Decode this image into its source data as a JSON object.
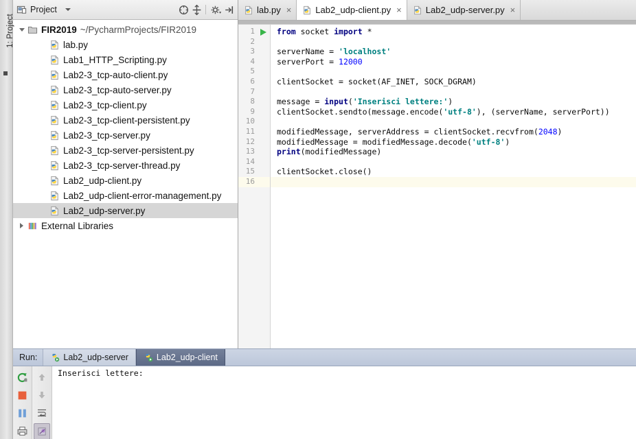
{
  "window": {
    "left_strip_tab": "1: Project"
  },
  "project_panel": {
    "title": "Project",
    "icon": "project-view-icon",
    "toolbar": [
      {
        "name": "collapse-all-icon",
        "label": "Collapse All"
      },
      {
        "name": "scroll-from-source-icon",
        "label": "Scroll from Source"
      },
      {
        "name": "gear-icon",
        "label": "Settings"
      },
      {
        "name": "hide-panel-icon",
        "label": "Hide"
      }
    ],
    "tree": [
      {
        "level": 1,
        "arrow": "down",
        "icon": "folder-icon",
        "name": "FIR2019",
        "bold": true,
        "path": "~/PycharmProjects/FIR2019",
        "selected": false
      },
      {
        "level": 2,
        "arrow": "none",
        "icon": "python-file-icon",
        "name": "lab.py",
        "bold": false,
        "path": "",
        "selected": false
      },
      {
        "level": 2,
        "arrow": "none",
        "icon": "python-file-icon",
        "name": "Lab1_HTTP_Scripting.py",
        "bold": false,
        "path": "",
        "selected": false
      },
      {
        "level": 2,
        "arrow": "none",
        "icon": "python-file-icon",
        "name": "Lab2-3_tcp-auto-client.py",
        "bold": false,
        "path": "",
        "selected": false
      },
      {
        "level": 2,
        "arrow": "none",
        "icon": "python-file-icon",
        "name": "Lab2-3_tcp-auto-server.py",
        "bold": false,
        "path": "",
        "selected": false
      },
      {
        "level": 2,
        "arrow": "none",
        "icon": "python-file-icon",
        "name": "Lab2-3_tcp-client.py",
        "bold": false,
        "path": "",
        "selected": false
      },
      {
        "level": 2,
        "arrow": "none",
        "icon": "python-file-icon",
        "name": "Lab2-3_tcp-client-persistent.py",
        "bold": false,
        "path": "",
        "selected": false
      },
      {
        "level": 2,
        "arrow": "none",
        "icon": "python-file-icon",
        "name": "Lab2-3_tcp-server.py",
        "bold": false,
        "path": "",
        "selected": false
      },
      {
        "level": 2,
        "arrow": "none",
        "icon": "python-file-icon",
        "name": "Lab2-3_tcp-server-persistent.py",
        "bold": false,
        "path": "",
        "selected": false
      },
      {
        "level": 2,
        "arrow": "none",
        "icon": "python-file-icon",
        "name": "Lab2-3_tcp-server-thread.py",
        "bold": false,
        "path": "",
        "selected": false
      },
      {
        "level": 2,
        "arrow": "none",
        "icon": "python-file-icon",
        "name": "Lab2_udp-client.py",
        "bold": false,
        "path": "",
        "selected": false
      },
      {
        "level": 2,
        "arrow": "none",
        "icon": "python-file-icon",
        "name": "Lab2_udp-client-error-management.py",
        "bold": false,
        "path": "",
        "selected": false
      },
      {
        "level": 2,
        "arrow": "none",
        "icon": "python-file-icon",
        "name": "Lab2_udp-server.py",
        "bold": false,
        "path": "",
        "selected": true
      },
      {
        "level": 1,
        "arrow": "right",
        "icon": "external-libraries-icon",
        "name": "External Libraries",
        "bold": false,
        "path": "",
        "selected": false
      }
    ]
  },
  "editor": {
    "tabs": [
      {
        "label": "lab.py",
        "active": false,
        "icon": "python-file-icon",
        "close": "×"
      },
      {
        "label": "Lab2_udp-client.py",
        "active": true,
        "icon": "python-file-icon",
        "close": "×"
      },
      {
        "label": "Lab2_udp-server.py",
        "active": false,
        "icon": "python-file-icon",
        "close": "×"
      }
    ],
    "current_line": 16,
    "run_marker_line": 1,
    "line_numbers": [
      "1",
      "2",
      "3",
      "4",
      "5",
      "6",
      "7",
      "8",
      "9",
      "10",
      "11",
      "12",
      "13",
      "14",
      "15",
      "16"
    ],
    "code_lines": [
      "from socket import *",
      "",
      "serverName = 'localhost'",
      "serverPort = 12000",
      "",
      "clientSocket = socket(AF_INET, SOCK_DGRAM)",
      "",
      "message = input('Inserisci lettere:')",
      "clientSocket.sendto(message.encode('utf-8'), (serverName, serverPort))",
      "",
      "modifiedMessage, serverAddress = clientSocket.recvfrom(2048)",
      "modifiedMessage = modifiedMessage.decode('utf-8')",
      "print(modifiedMessage)",
      "",
      "clientSocket.close()",
      ""
    ]
  },
  "run_panel": {
    "label": "Run:",
    "tabs": [
      {
        "label": "Lab2_udp-server",
        "active": false,
        "icon": "python-run-icon"
      },
      {
        "label": "Lab2_udp-client",
        "active": true,
        "icon": "python-run-icon"
      }
    ],
    "toolbar_left": [
      {
        "name": "rerun-icon",
        "label": "Rerun"
      },
      {
        "name": "stop-icon",
        "label": "Stop"
      },
      {
        "name": "pause-icon",
        "label": "Pause Output"
      },
      {
        "name": "print-icon",
        "label": "Print"
      }
    ],
    "toolbar_right": [
      {
        "name": "up-arrow-icon",
        "label": "Up"
      },
      {
        "name": "down-arrow-icon",
        "label": "Down"
      },
      {
        "name": "soft-wrap-icon",
        "label": "Soft-Wrap"
      },
      {
        "name": "filter-icon",
        "label": "Filter",
        "pressed": true
      }
    ],
    "console_output": "Inserisci lettere:"
  },
  "colors": {
    "accent_blue": "#5d6a86",
    "keyword": "#000080",
    "string": "#008080",
    "number": "#0000ff",
    "run_green": "#39b54a",
    "stop_red": "#e8603c",
    "current_line": "#fdfbec",
    "selection_gray": "#d6d6d6"
  }
}
